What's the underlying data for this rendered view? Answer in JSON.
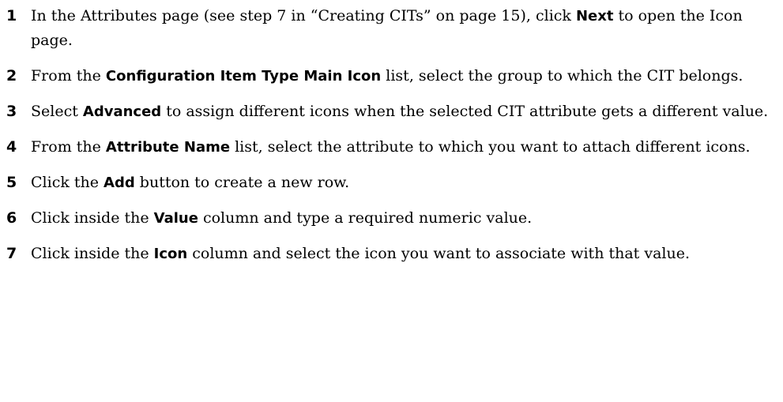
{
  "steps": [
    {
      "number": "1",
      "parts": [
        {
          "t": "In the Attributes page (see step 7 in “Creating CITs” on page 15), click "
        },
        {
          "t": "Next",
          "bold": true
        },
        {
          "t": " to open the Icon page."
        }
      ]
    },
    {
      "number": "2",
      "parts": [
        {
          "t": "From the "
        },
        {
          "t": "Configuration Item Type Main Icon",
          "bold": true
        },
        {
          "t": " list, select the group to which the CIT belongs."
        }
      ]
    },
    {
      "number": "3",
      "parts": [
        {
          "t": "Select "
        },
        {
          "t": "Advanced",
          "bold": true
        },
        {
          "t": " to assign different icons when the selected CIT attribute gets a different value."
        }
      ]
    },
    {
      "number": "4",
      "parts": [
        {
          "t": "From the "
        },
        {
          "t": "Attribute Name",
          "bold": true
        },
        {
          "t": " list, select the attribute to which you want to attach different icons."
        }
      ]
    },
    {
      "number": "5",
      "parts": [
        {
          "t": "Click the "
        },
        {
          "t": "Add",
          "bold": true
        },
        {
          "t": " button to create a new row."
        }
      ]
    },
    {
      "number": "6",
      "parts": [
        {
          "t": "Click inside the "
        },
        {
          "t": "Value",
          "bold": true
        },
        {
          "t": " column and type a required numeric value."
        }
      ]
    },
    {
      "number": "7",
      "parts": [
        {
          "t": "Click inside the "
        },
        {
          "t": "Icon",
          "bold": true
        },
        {
          "t": " column and select the icon you want to associate with that value."
        }
      ]
    }
  ]
}
